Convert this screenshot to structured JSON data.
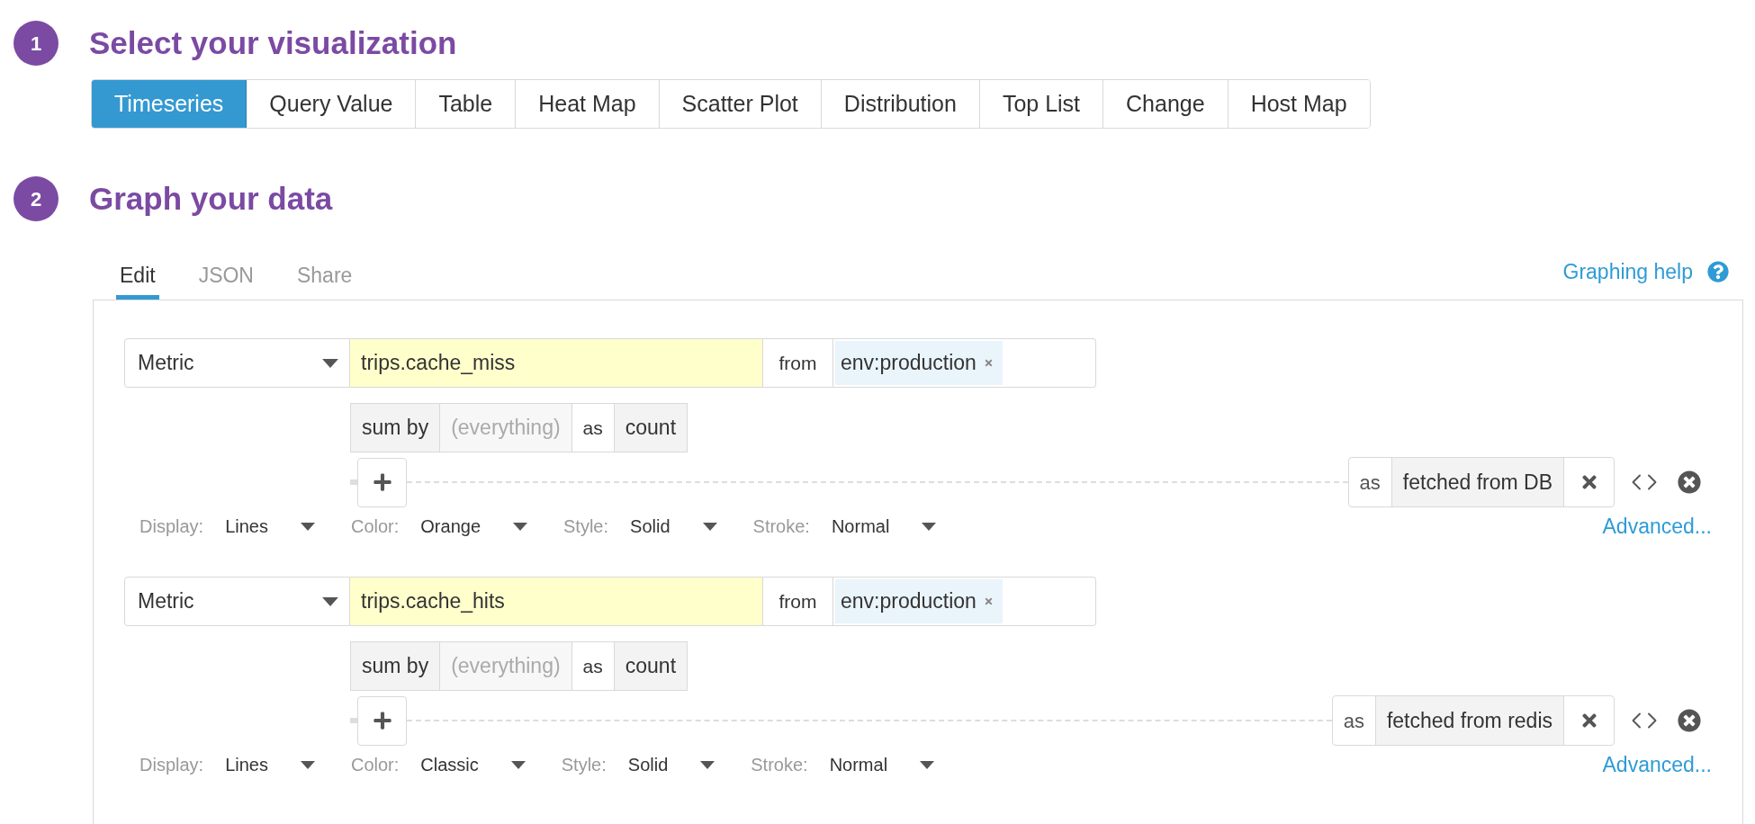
{
  "steps": [
    {
      "number": "1",
      "title": "Select your visualization"
    },
    {
      "number": "2",
      "title": "Graph your data"
    }
  ],
  "visualization_types": [
    {
      "label": "Timeseries",
      "selected": true
    },
    {
      "label": "Query Value",
      "selected": false
    },
    {
      "label": "Table",
      "selected": false
    },
    {
      "label": "Heat Map",
      "selected": false
    },
    {
      "label": "Scatter Plot",
      "selected": false
    },
    {
      "label": "Distribution",
      "selected": false
    },
    {
      "label": "Top List",
      "selected": false
    },
    {
      "label": "Change",
      "selected": false
    },
    {
      "label": "Host Map",
      "selected": false
    }
  ],
  "editor_tabs": [
    {
      "label": "Edit",
      "selected": true
    },
    {
      "label": "JSON",
      "selected": false
    },
    {
      "label": "Share",
      "selected": false
    }
  ],
  "help_link": "Graphing help",
  "queries": [
    {
      "source_type": "Metric",
      "metric": "trips.cache_miss",
      "from_label": "from",
      "tags": [
        "env:production"
      ],
      "aggregation": "sum by",
      "group_by_placeholder": "(everything)",
      "as_label": "as",
      "as_value": "count",
      "alias_label": "as",
      "alias": "fetched from DB",
      "options": [
        {
          "label": "Display:",
          "value": "Lines"
        },
        {
          "label": "Color:",
          "value": "Orange"
        },
        {
          "label": "Style:",
          "value": "Solid"
        },
        {
          "label": "Stroke:",
          "value": "Normal"
        }
      ],
      "advanced": "Advanced..."
    },
    {
      "source_type": "Metric",
      "metric": "trips.cache_hits",
      "from_label": "from",
      "tags": [
        "env:production"
      ],
      "aggregation": "sum by",
      "group_by_placeholder": "(everything)",
      "as_label": "as",
      "as_value": "count",
      "alias_label": "as",
      "alias": "fetched from redis",
      "options": [
        {
          "label": "Display:",
          "value": "Lines"
        },
        {
          "label": "Color:",
          "value": "Classic"
        },
        {
          "label": "Style:",
          "value": "Solid"
        },
        {
          "label": "Stroke:",
          "value": "Normal"
        }
      ],
      "advanced": "Advanced..."
    }
  ]
}
